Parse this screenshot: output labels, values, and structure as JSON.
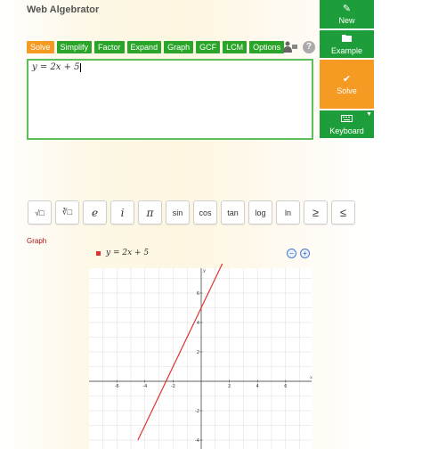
{
  "app": {
    "title": "Web Algebrator"
  },
  "side_buttons": {
    "new": {
      "label": "New",
      "icon": "pencil-icon"
    },
    "example": {
      "label": "Example",
      "icon": "folder-icon"
    },
    "solve": {
      "label": "Solve",
      "icon": "check-icon"
    },
    "keyboard": {
      "label": "Keyboard",
      "icon": "keyboard-icon"
    }
  },
  "tabs": [
    "Solve",
    "Simplify",
    "Factor",
    "Expand",
    "Graph",
    "GCF",
    "LCM",
    "Options"
  ],
  "active_tab": "Solve",
  "input": {
    "value": "y = 2x + 5"
  },
  "keypad": [
    "√□",
    "∛□",
    "e",
    "i",
    "π",
    "sin",
    "cos",
    "tan",
    "log",
    "ln",
    "≥",
    "≤"
  ],
  "graph": {
    "section_label": "Graph",
    "legend_label": "y = 2x + 5",
    "zoom_out": "−",
    "zoom_in": "+"
  },
  "colors": {
    "green": "#1e9e3a",
    "orange": "#f59a23",
    "line": "#d33"
  },
  "chart_data": {
    "type": "line",
    "series": [
      {
        "name": "y = 2x + 5",
        "x": [
          -4.5,
          1.5
        ],
        "y": [
          -4,
          8
        ]
      }
    ],
    "xlim": [
      -8,
      8
    ],
    "ylim": [
      -4.4,
      8
    ],
    "xticks": [
      -6,
      -4,
      -2,
      2,
      4,
      6
    ],
    "yticks": [
      -4,
      -2,
      2,
      4,
      6
    ],
    "xlabel": "x",
    "ylabel": "y",
    "grid": true
  }
}
